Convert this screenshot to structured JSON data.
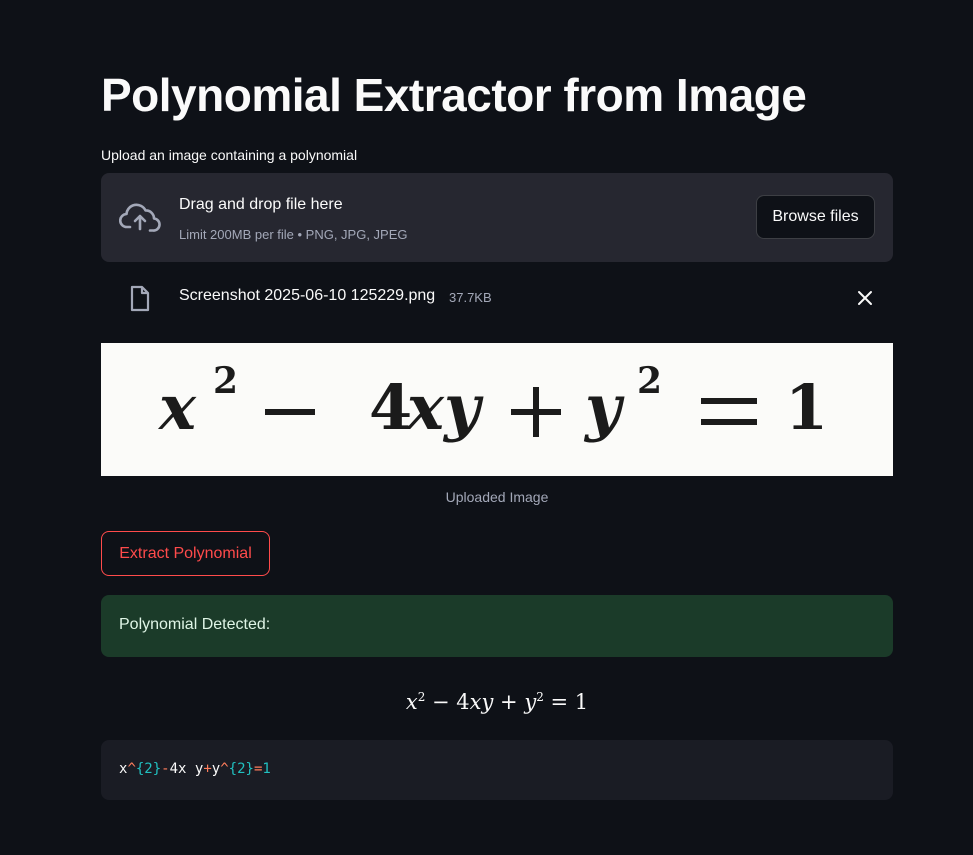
{
  "page": {
    "title": "Polynomial Extractor from Image"
  },
  "uploader": {
    "label": "Upload an image containing a polynomial",
    "drop_title": "Drag and drop file here",
    "drop_subtitle": "Limit 200MB per file • PNG, JPG, JPEG",
    "browse_label": "Browse files",
    "upload_icon": "cloud-upload-icon"
  },
  "file": {
    "name": "Screenshot 2025-06-10 125229.png",
    "size": "37.7KB",
    "file_icon": "file-icon",
    "remove_icon": "close-icon"
  },
  "image": {
    "caption": "Uploaded Image",
    "equation_text": "x² − 4xy + y² = 1"
  },
  "actions": {
    "extract_label": "Extract Polynomial"
  },
  "result": {
    "success_message": "Polynomial Detected:",
    "rendered": {
      "t1": "x",
      "t1_sup": "2",
      "op1": " − 4",
      "t2": "xy",
      "op2": " + ",
      "t3": "y",
      "t3_sup": "2",
      "rhs": " = 1"
    },
    "code_tokens": {
      "a": "x",
      "b": "^",
      "c": "{2}",
      "d": "-",
      "e": "4x y",
      "f": "+",
      "g": "y",
      "h": "^",
      "i": "{2}",
      "j": "=",
      "k": "1"
    }
  },
  "colors": {
    "background": "#0e1117",
    "accent": "#ff4b4b",
    "success_bg": "#1b3b29",
    "dropzone_bg": "#262730",
    "code_bg": "#1a1c24"
  }
}
